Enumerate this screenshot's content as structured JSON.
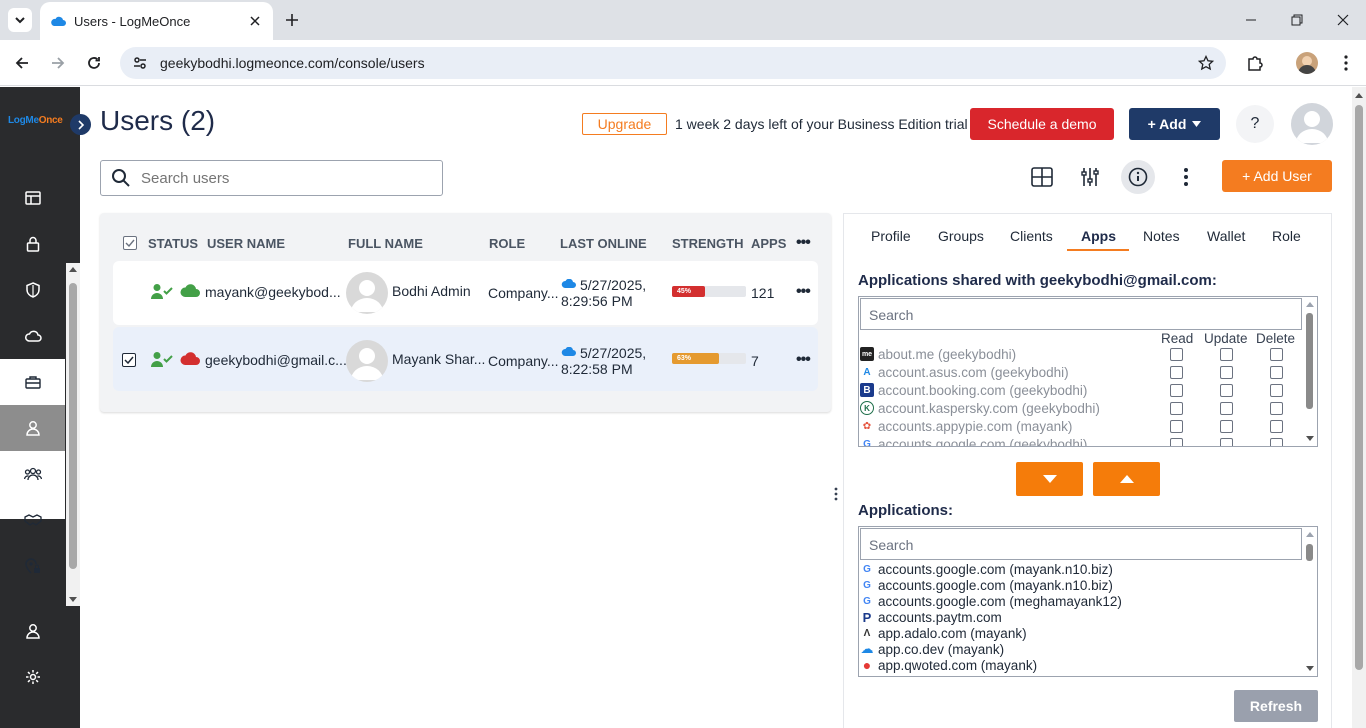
{
  "browser": {
    "tab_title": "Users - LogMeOnce",
    "url": "geekybodhi.logmeonce.com/console/users"
  },
  "logo": {
    "part1": "LogMe",
    "part2": "Once"
  },
  "sidebar": {
    "items": [
      {
        "icon": "dashboard-icon"
      },
      {
        "icon": "lock-icon"
      },
      {
        "icon": "shield-icon"
      },
      {
        "icon": "cloud-icon"
      },
      {
        "icon": "toolbox-icon"
      },
      {
        "icon": "user-icon",
        "active": true
      },
      {
        "icon": "users-group-icon"
      },
      {
        "icon": "handshake-icon"
      },
      {
        "icon": "location-lock-icon"
      }
    ],
    "bottom": [
      {
        "icon": "profile-icon"
      },
      {
        "icon": "settings-icon"
      }
    ]
  },
  "header": {
    "title": "Users (2)",
    "upgrade": "Upgrade",
    "trial": "1 week 2 days left of your Business Edition trial",
    "demo": "Schedule a demo",
    "add": "+ Add",
    "help": "?"
  },
  "search": {
    "placeholder": "Search users"
  },
  "add_user": "+ Add User",
  "table": {
    "headers": {
      "status": "STATUS",
      "username": "USER NAME",
      "fullname": "FULL NAME",
      "role": "ROLE",
      "last_online": "LAST ONLINE",
      "strength": "STRENGTH",
      "apps": "APPS"
    },
    "rows": [
      {
        "username": "mayank@geekybod...",
        "fullname": "Bodhi Admin",
        "role": "Company...",
        "date": "5/27/2025,",
        "time": "8:29:56 PM",
        "strength_label": "45%",
        "strength": 45,
        "apps": "121",
        "cloud_color": "#43a047",
        "checked": false
      },
      {
        "username": "geekybodhi@gmail.c...",
        "fullname": "Mayank Shar...",
        "role": "Company...",
        "date": "5/27/2025,",
        "time": "8:22:58 PM",
        "strength_label": "63%",
        "strength": 63,
        "apps": "7",
        "cloud_color": "#d32f2f",
        "checked": true
      }
    ]
  },
  "panel": {
    "tabs": [
      "Profile",
      "Groups",
      "Clients",
      "Apps",
      "Notes",
      "Wallet",
      "Role"
    ],
    "active_tab": "Apps",
    "shared_title": "Applications shared with geekybodhi@gmail.com:",
    "shared_search": "Search",
    "perm_headers": [
      "Read",
      "Update",
      "Delete"
    ],
    "shared_apps": [
      {
        "name": "about.me (geekybodhi)",
        "icon": "me"
      },
      {
        "name": "account.asus.com (geekybodhi)",
        "icon": "A"
      },
      {
        "name": "account.booking.com (geekybodhi)",
        "icon": "B"
      },
      {
        "name": "account.kaspersky.com (geekybodhi)",
        "icon": "K"
      },
      {
        "name": "accounts.appypie.com (mayank)",
        "icon": "✿"
      },
      {
        "name": "accounts.google.com (geekybodhi)",
        "icon": "G"
      }
    ],
    "apps_title": "Applications:",
    "apps_search": "Search",
    "apps": [
      {
        "name": "accounts.google.com (mayank.n10.biz)",
        "icon": "G"
      },
      {
        "name": "accounts.google.com (mayank.n10.biz)",
        "icon": "G"
      },
      {
        "name": "accounts.google.com (meghamayank12)",
        "icon": "G"
      },
      {
        "name": "accounts.paytm.com",
        "icon": "P"
      },
      {
        "name": "app.adalo.com (mayank)",
        "icon": "Λ"
      },
      {
        "name": "app.co.dev (mayank)",
        "icon": "☁"
      },
      {
        "name": "app.qwoted.com (mayank)",
        "icon": "●"
      }
    ],
    "refresh": "Refresh"
  }
}
